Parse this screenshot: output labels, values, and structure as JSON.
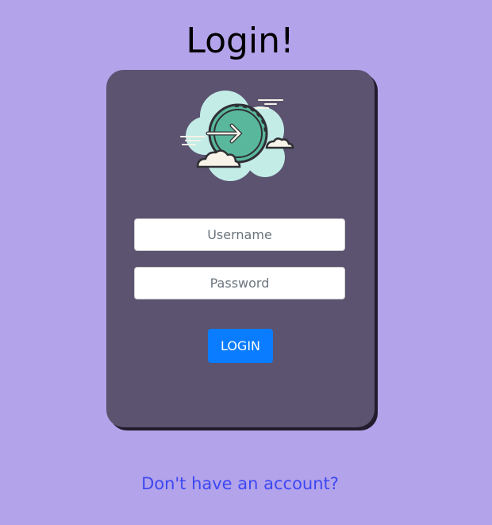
{
  "page": {
    "title": "Login!"
  },
  "form": {
    "username_placeholder": "Username",
    "password_placeholder": "Password",
    "login_label": "LOGIN"
  },
  "footer": {
    "signup_link": "Don't have an account?"
  },
  "illustration": {
    "icon": "login-cloud-arrow-icon"
  },
  "colors": {
    "background": "#b3a3ea",
    "card": "#5b5370",
    "button": "#0a7cff",
    "link": "#3d48f2",
    "icon_cloud": "#c4ece7",
    "icon_circle": "#59b89b"
  }
}
